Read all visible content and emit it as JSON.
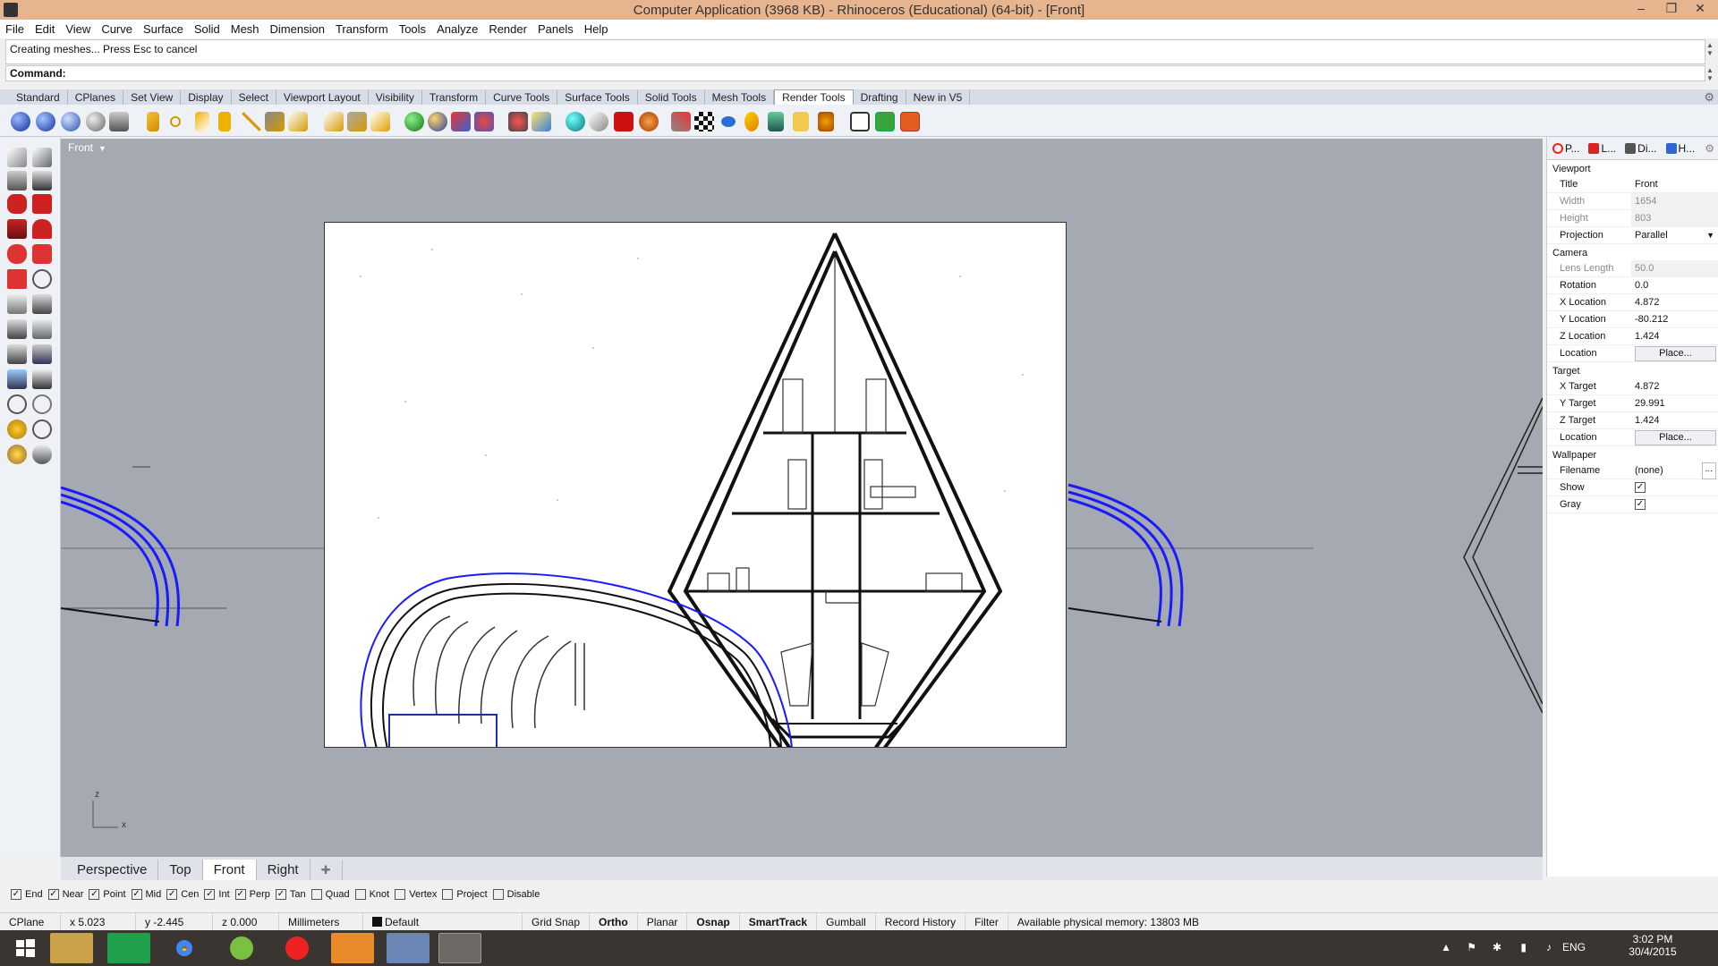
{
  "window": {
    "title": "Computer Application (3968 KB) - Rhinoceros (Educational) (64-bit) - [Front]"
  },
  "menu": [
    "File",
    "Edit",
    "View",
    "Curve",
    "Surface",
    "Solid",
    "Mesh",
    "Dimension",
    "Transform",
    "Tools",
    "Analyze",
    "Render",
    "Panels",
    "Help"
  ],
  "command": {
    "history": "Creating meshes... Press Esc to cancel",
    "prompt": "Command:"
  },
  "toolbar_tabs": [
    "Standard",
    "CPlanes",
    "Set View",
    "Display",
    "Select",
    "Viewport Layout",
    "Visibility",
    "Transform",
    "Curve Tools",
    "Surface Tools",
    "Solid Tools",
    "Mesh Tools",
    "Render Tools",
    "Drafting",
    "New in V5"
  ],
  "active_toolbar_tab": "Render Tools",
  "viewport": {
    "title": "Front",
    "axis_z": "z",
    "axis_x": "x"
  },
  "viewport_tabs": [
    "Perspective",
    "Top",
    "Front",
    "Right"
  ],
  "active_viewport_tab": "Front",
  "panel": {
    "tabs": [
      "P...",
      "L...",
      "Di...",
      "H..."
    ],
    "viewport_section": "Viewport",
    "title_label": "Title",
    "title_value": "Front",
    "width_label": "Width",
    "width_value": "1654",
    "height_label": "Height",
    "height_value": "803",
    "projection_label": "Projection",
    "projection_value": "Parallel",
    "camera_section": "Camera",
    "lens_label": "Lens Length",
    "lens_value": "50.0",
    "rotation_label": "Rotation",
    "rotation_value": "0.0",
    "xloc_label": "X Location",
    "xloc_value": "4.872",
    "yloc_label": "Y Location",
    "yloc_value": "-80.212",
    "zloc_label": "Z Location",
    "zloc_value": "1.424",
    "loc_label": "Location",
    "place_button": "Place...",
    "target_section": "Target",
    "xt_label": "X Target",
    "xt_value": "4.872",
    "yt_label": "Y Target",
    "yt_value": "29.991",
    "zt_label": "Z Target",
    "zt_value": "1.424",
    "tloc_label": "Location",
    "wallpaper_section": "Wallpaper",
    "filename_label": "Filename",
    "filename_value": "(none)",
    "browse_button": "...",
    "show_label": "Show",
    "gray_label": "Gray"
  },
  "osnap": [
    {
      "label": "End",
      "checked": true
    },
    {
      "label": "Near",
      "checked": true
    },
    {
      "label": "Point",
      "checked": true
    },
    {
      "label": "Mid",
      "checked": true
    },
    {
      "label": "Cen",
      "checked": true
    },
    {
      "label": "Int",
      "checked": true
    },
    {
      "label": "Perp",
      "checked": true
    },
    {
      "label": "Tan",
      "checked": true
    },
    {
      "label": "Quad",
      "checked": false
    },
    {
      "label": "Knot",
      "checked": false
    },
    {
      "label": "Vertex",
      "checked": false
    },
    {
      "label": "Project",
      "checked": false
    },
    {
      "label": "Disable",
      "checked": false
    }
  ],
  "status": {
    "cplane": "CPlane",
    "x": "x 5.023",
    "y": "y -2.445",
    "z": "z 0.000",
    "units": "Millimeters",
    "layer": "Default",
    "grid_snap": "Grid Snap",
    "ortho": "Ortho",
    "planar": "Planar",
    "osnap": "Osnap",
    "smarttrack": "SmartTrack",
    "gumball": "Gumball",
    "record_history": "Record History",
    "filter": "Filter",
    "memory": "Available physical memory: 13803 MB"
  },
  "tray": {
    "lang": "ENG",
    "time": "3:02 PM",
    "date": "30/4/2015"
  },
  "colors": {
    "titlebar": "#e6b48e",
    "viewport_bg": "#a4a9b2",
    "selected_curve": "#1a1aff",
    "taskbar": "#3a3530"
  }
}
